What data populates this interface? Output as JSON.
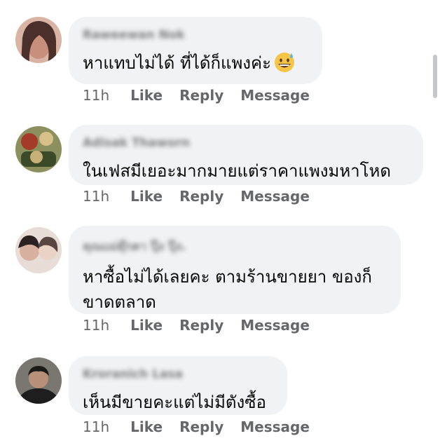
{
  "comments": [
    {
      "author": "Raweewan Nok",
      "text": "หาแทบไม่ได้ ที่ได้ก็แพงค่ะ",
      "emoji": "grinning-sweat-emoji",
      "time": "11h",
      "like_label": "Like",
      "reply_label": "Reply",
      "message_label": "Message"
    },
    {
      "author": "Adisak Thaworn",
      "text": "ในเฟสมีเยอะมากมายแต่ราคาแพงมหาโหด",
      "time": "11h",
      "like_label": "Like",
      "reply_label": "Reply",
      "message_label": "Message"
    },
    {
      "author": "คุณแม่ตุ๊กตา ปุ๊ง ปุ๊ง.",
      "text_line1": "หาซื้อไม่ได้เลยคะ  ตามร้านขายยา ของก็",
      "text_line2": "ขาดตลาด",
      "time": "11h",
      "like_label": "Like",
      "reply_label": "Reply",
      "message_label": "Message"
    },
    {
      "author": "Kroranich Lasa",
      "text": "เห็นมีขายคะแต่ไม่มีตังซื้อ",
      "time": "11h",
      "like_label": "Like",
      "reply_label": "Reply",
      "message_label": "Message"
    }
  ],
  "colors": {
    "bubble": "#f0f2f5",
    "meta_text": "#65676b",
    "body_text": "#050505"
  }
}
